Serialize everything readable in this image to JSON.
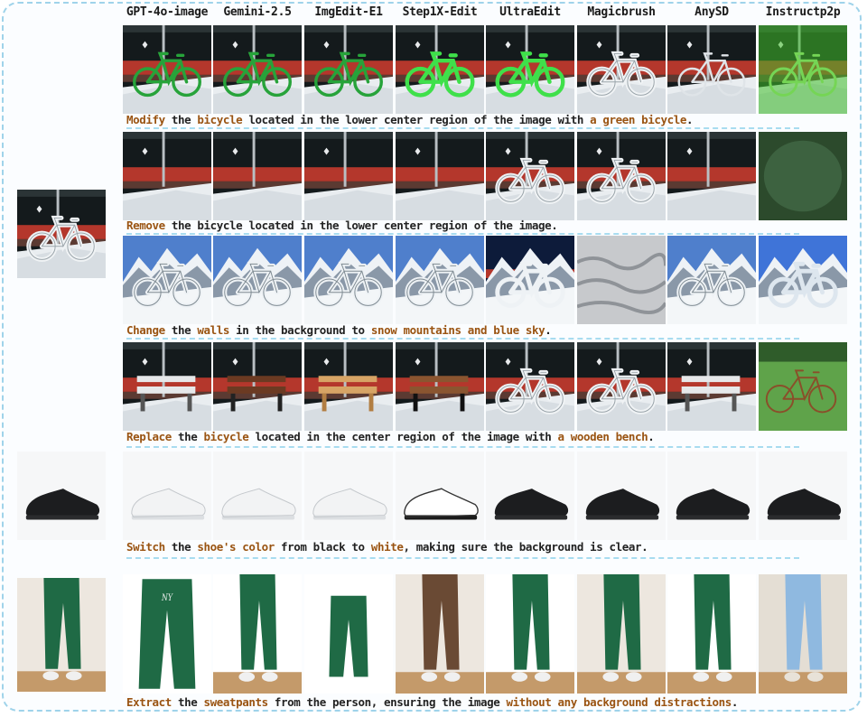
{
  "columns": [
    "GPT-4o-image",
    "Gemini-2.5",
    "ImgEdit-E1",
    "Step1X-Edit",
    "UltraEdit",
    "Magicbrush",
    "AnySD",
    "Instructp2p"
  ],
  "rows": [
    {
      "instruction": [
        {
          "text": "Modify",
          "hl": true
        },
        {
          "text": " the ",
          "hl": false
        },
        {
          "text": "bicycle",
          "hl": true
        },
        {
          "text": " located in the lower center region of the image with ",
          "hl": false
        },
        {
          "text": "a green bicycle",
          "hl": true
        },
        {
          "text": ".",
          "hl": false
        }
      ],
      "cells": [
        "bike-green",
        "bike-green",
        "bike-green",
        "bike-green-bright",
        "bike-green-bright",
        "bike-snow",
        "bike-white",
        "green-wash"
      ]
    },
    {
      "instruction": [
        {
          "text": "Remove",
          "hl": true
        },
        {
          "text": " the bicycle located in the lower center region of the image.",
          "hl": false
        }
      ],
      "cells": [
        "empty-street",
        "empty-street",
        "empty-street",
        "empty-street",
        "bike-snow",
        "bike-snow",
        "empty-street",
        "green-grass"
      ]
    },
    {
      "instruction": [
        {
          "text": "Change",
          "hl": true
        },
        {
          "text": " the ",
          "hl": false
        },
        {
          "text": "walls",
          "hl": true
        },
        {
          "text": " in the background to ",
          "hl": false
        },
        {
          "text": "snow mountains and blue sky",
          "hl": true
        },
        {
          "text": ".",
          "hl": false
        }
      ],
      "cells": [
        "bike-mountain",
        "bike-mountain",
        "bike-mountain",
        "bike-mountain",
        "bike-mountain-night",
        "snow-texture",
        "bike-mountain",
        "bike-mountain-pale"
      ]
    },
    {
      "instruction": [
        {
          "text": "Replace",
          "hl": true
        },
        {
          "text": " the ",
          "hl": false
        },
        {
          "text": "bicycle",
          "hl": true
        },
        {
          "text": " located in the center region of the image with ",
          "hl": false
        },
        {
          "text": "a wooden bench",
          "hl": true
        },
        {
          "text": ".",
          "hl": false
        }
      ],
      "cells": [
        "bench-white",
        "bench-dark",
        "bench-wood",
        "bench-black",
        "bike-snow",
        "bike-snow",
        "bench-white",
        "park-bikes"
      ]
    },
    {
      "instruction": [
        {
          "text": "Switch",
          "hl": true
        },
        {
          "text": " the ",
          "hl": false
        },
        {
          "text": "shoe's color",
          "hl": true
        },
        {
          "text": " from black to ",
          "hl": false
        },
        {
          "text": "white",
          "hl": true
        },
        {
          "text": ", making sure the background is clear.",
          "hl": false
        }
      ],
      "cells": [
        "shoe-white",
        "shoe-white",
        "shoe-white",
        "shoe-white-black",
        "shoe-black",
        "shoe-black",
        "shoe-black",
        "shoe-black"
      ]
    },
    {
      "instruction": [
        {
          "text": "Extract",
          "hl": true
        },
        {
          "text": " the ",
          "hl": false
        },
        {
          "text": "sweatpants",
          "hl": true
        },
        {
          "text": " from the person, ensuring the image ",
          "hl": false
        },
        {
          "text": "without any background distractions",
          "hl": true
        },
        {
          "text": ".",
          "hl": false
        }
      ],
      "cells": [
        "pants-flat",
        "pants-legs",
        "pants-flat-small",
        "pants-brown",
        "pants-legs-crop",
        "pants-legs-full",
        "pants-legs-crop",
        "pants-blue"
      ]
    }
  ],
  "sources": [
    "bike-snow",
    "shoe-black",
    "pants-person"
  ],
  "palette": {
    "highlight": "#9a5412",
    "text": "#222222",
    "frame": "#9fd3ea"
  }
}
